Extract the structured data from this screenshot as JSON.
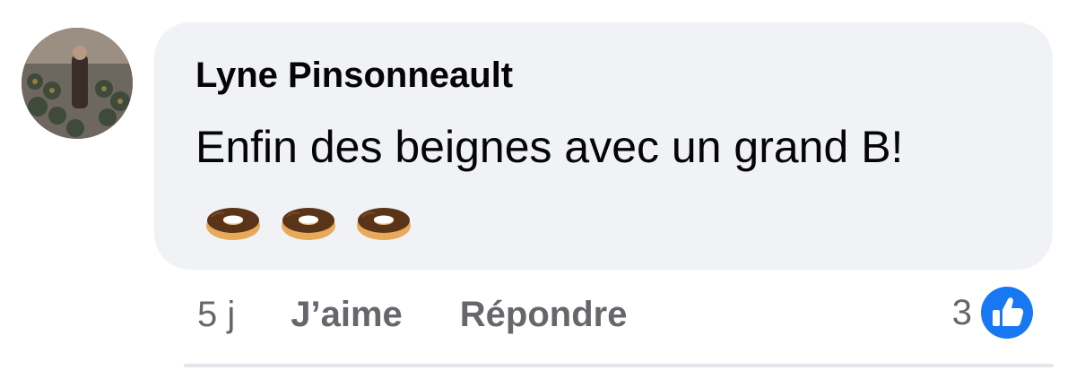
{
  "comment": {
    "author": "Lyne Pinsonneault",
    "text": "Enfin des beignes avec un grand B!",
    "emojis": [
      "doughnut-icon",
      "doughnut-icon",
      "doughnut-icon"
    ],
    "bubble_color": "#f0f2f5"
  },
  "actions": {
    "timestamp": "5 j",
    "like_label": "J’aime",
    "reply_label": "Répondre"
  },
  "reactions": {
    "count": "3",
    "icon": "thumbs-up-icon",
    "icon_color": "#1877f2"
  }
}
